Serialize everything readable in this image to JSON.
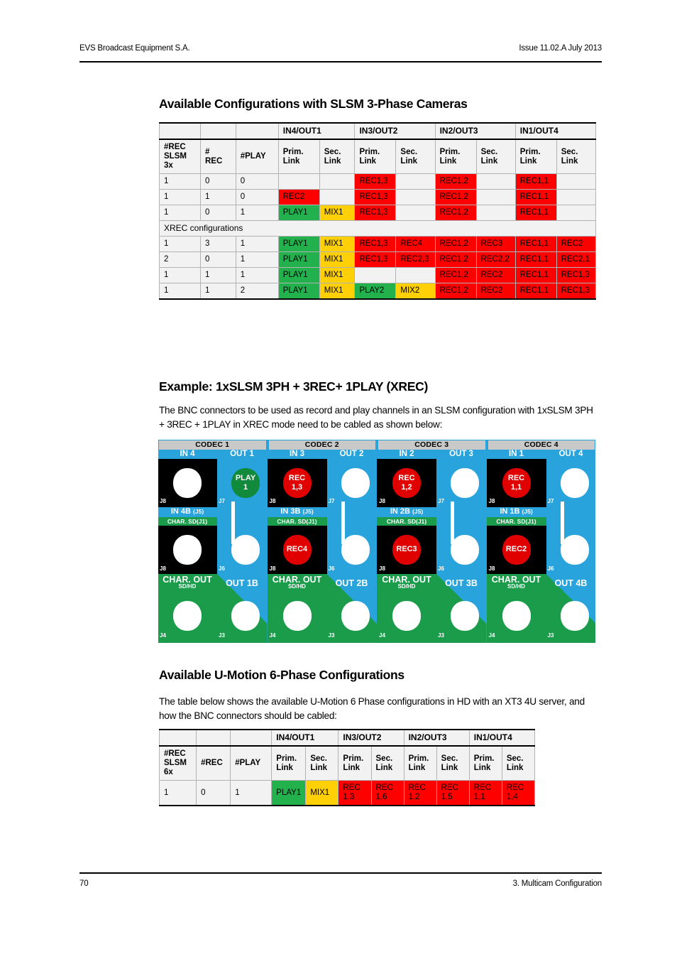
{
  "header": {
    "company": "EVS Broadcast Equipment S.A.",
    "issue": "Issue 11.02.A  July 2013"
  },
  "footer": {
    "page_number": "70",
    "chapter": "3. Multicam Configuration"
  },
  "sections": {
    "title_1": "Available Configurations with SLSM 3-Phase Cameras",
    "title_2": "Example: 1xSLSM 3PH + 3REC+ 1PLAY (XREC)",
    "title_3": "Available U-Motion 6-Phase Configurations",
    "para_1": "The BNC connectors to be used as record and play channels in an SLSM configuration with 1xSLSM 3PH + 3REC + 1PLAY in XREC mode need to be cabled as shown below:",
    "para_2": "The table below shows the available U-Motion 6 Phase configurations in HD with an XT3 4U server, and how the BNC connectors should be cabled:"
  },
  "colors": {
    "rec": "#fe0000",
    "play": "#22b14c",
    "mix": "#ffd005",
    "panel_blue": "#29a3dc",
    "panel_green": "#1a9c4b",
    "codec_bar": "#c9c9c9"
  },
  "table_1": {
    "group_headers": [
      "",
      "",
      "",
      "IN4/OUT1",
      "IN3/OUT2",
      "IN2/OUT3",
      "IN1/OUT4"
    ],
    "sub_headers": [
      "#REC SLSM 3x",
      "# REC",
      "#PLAY",
      "Prim. Link",
      "Sec. Link",
      "Prim. Link",
      "Sec. Link",
      "Prim. Link",
      "Sec. Link",
      "Prim. Link",
      "Sec. Link"
    ],
    "sub_headers_split": [
      {
        "l1": "#REC",
        "l2": "SLSM",
        "l3": "3x"
      },
      {
        "l1": "#",
        "l2": "REC"
      },
      {
        "l1": "#PLAY"
      },
      {
        "l1": "Prim.",
        "l2": "Link"
      },
      {
        "l1": "Sec.",
        "l2": "Link"
      },
      {
        "l1": "Prim.",
        "l2": "Link"
      },
      {
        "l1": "Sec.",
        "l2": "Link"
      },
      {
        "l1": "Prim.",
        "l2": "Link"
      },
      {
        "l1": "Sec.",
        "l2": "Link"
      },
      {
        "l1": "Prim.",
        "l2": "Link"
      },
      {
        "l1": "Sec.",
        "l2": "Link"
      }
    ],
    "section_label": "XREC configurations",
    "rows": [
      {
        "cells": [
          {
            "t": "1",
            "k": "plain"
          },
          {
            "t": "0",
            "k": "plain"
          },
          {
            "t": "0",
            "k": "plain"
          },
          {
            "t": "",
            "k": "empty"
          },
          {
            "t": "",
            "k": "empty"
          },
          {
            "t": "REC1,3",
            "k": "rec"
          },
          {
            "t": "",
            "k": "empty"
          },
          {
            "t": "REC1,2",
            "k": "rec"
          },
          {
            "t": "",
            "k": "empty"
          },
          {
            "t": "REC1,1",
            "k": "rec"
          },
          {
            "t": "",
            "k": "empty"
          }
        ]
      },
      {
        "cells": [
          {
            "t": "1",
            "k": "plain"
          },
          {
            "t": "1",
            "k": "plain"
          },
          {
            "t": "0",
            "k": "plain"
          },
          {
            "t": "REC2",
            "k": "rec"
          },
          {
            "t": "",
            "k": "empty"
          },
          {
            "t": "REC1,3",
            "k": "rec"
          },
          {
            "t": "",
            "k": "empty"
          },
          {
            "t": "REC1,2",
            "k": "rec"
          },
          {
            "t": "",
            "k": "empty"
          },
          {
            "t": "REC1,1",
            "k": "rec"
          },
          {
            "t": "",
            "k": "empty"
          }
        ]
      },
      {
        "cells": [
          {
            "t": "1",
            "k": "plain"
          },
          {
            "t": "0",
            "k": "plain"
          },
          {
            "t": "1",
            "k": "plain"
          },
          {
            "t": "PLAY1",
            "k": "play"
          },
          {
            "t": "MIX1",
            "k": "mix"
          },
          {
            "t": "REC1,3",
            "k": "rec"
          },
          {
            "t": "",
            "k": "empty"
          },
          {
            "t": "REC1,2",
            "k": "rec"
          },
          {
            "t": "",
            "k": "empty"
          },
          {
            "t": "REC1,1",
            "k": "rec"
          },
          {
            "t": "",
            "k": "empty"
          }
        ]
      }
    ],
    "xrec_rows": [
      {
        "cells": [
          {
            "t": "1",
            "k": "plain"
          },
          {
            "t": "3",
            "k": "plain"
          },
          {
            "t": "1",
            "k": "plain"
          },
          {
            "t": "PLAY1",
            "k": "play"
          },
          {
            "t": "MIX1",
            "k": "mix"
          },
          {
            "t": "REC1,3",
            "k": "rec"
          },
          {
            "t": "REC4",
            "k": "rec"
          },
          {
            "t": "REC1,2",
            "k": "rec"
          },
          {
            "t": "REC3",
            "k": "rec"
          },
          {
            "t": "REC1,1",
            "k": "rec"
          },
          {
            "t": "REC2",
            "k": "rec"
          }
        ]
      },
      {
        "cells": [
          {
            "t": "2",
            "k": "plain"
          },
          {
            "t": "0",
            "k": "plain"
          },
          {
            "t": "1",
            "k": "plain"
          },
          {
            "t": "PLAY1",
            "k": "play"
          },
          {
            "t": "MIX1",
            "k": "mix"
          },
          {
            "t": "REC1,3",
            "k": "rec"
          },
          {
            "t": "REC2,3",
            "k": "rec"
          },
          {
            "t": "REC1,2",
            "k": "rec"
          },
          {
            "t": "REC2,2",
            "k": "rec"
          },
          {
            "t": "REC1,1",
            "k": "rec"
          },
          {
            "t": "REC2,1",
            "k": "rec"
          }
        ]
      },
      {
        "cells": [
          {
            "t": "1",
            "k": "plain"
          },
          {
            "t": "1",
            "k": "plain"
          },
          {
            "t": "1",
            "k": "plain"
          },
          {
            "t": "PLAY1",
            "k": "play"
          },
          {
            "t": "MIX1",
            "k": "mix"
          },
          {
            "t": "",
            "k": "empty"
          },
          {
            "t": "",
            "k": "empty"
          },
          {
            "t": "REC1,2",
            "k": "rec"
          },
          {
            "t": "REC2",
            "k": "rec"
          },
          {
            "t": "REC1,1",
            "k": "rec"
          },
          {
            "t": "REC1,3",
            "k": "rec"
          }
        ]
      },
      {
        "cells": [
          {
            "t": "1",
            "k": "plain"
          },
          {
            "t": "1",
            "k": "plain"
          },
          {
            "t": "2",
            "k": "plain"
          },
          {
            "t": "PLAY1",
            "k": "play"
          },
          {
            "t": "MIX1",
            "k": "mix"
          },
          {
            "t": "PLAY2",
            "k": "play"
          },
          {
            "t": "MIX2",
            "k": "mix"
          },
          {
            "t": "REC1,2",
            "k": "rec"
          },
          {
            "t": "REC2",
            "k": "rec"
          },
          {
            "t": "REC1,1",
            "k": "rec"
          },
          {
            "t": "REC1,3",
            "k": "rec"
          }
        ]
      }
    ]
  },
  "table_2": {
    "group_headers": [
      "",
      "",
      "",
      "IN4/OUT1",
      "IN3/OUT2",
      "IN2/OUT3",
      "IN1/OUT4"
    ],
    "sub_headers_split": [
      {
        "l1": "#REC",
        "l2": "SLSM",
        "l3": "6x"
      },
      {
        "l1": "#REC"
      },
      {
        "l1": "#PLAY"
      },
      {
        "l1": "Prim.",
        "l2": "Link"
      },
      {
        "l1": "Sec.",
        "l2": "Link"
      },
      {
        "l1": "Prim.",
        "l2": "Link"
      },
      {
        "l1": "Sec.",
        "l2": "Link"
      },
      {
        "l1": "Prim.",
        "l2": "Link"
      },
      {
        "l1": "Sec.",
        "l2": "Link"
      },
      {
        "l1": "Prim.",
        "l2": "Link"
      },
      {
        "l1": "Sec.",
        "l2": "Link"
      }
    ],
    "rows": [
      {
        "cells": [
          {
            "t": "1",
            "k": "plain"
          },
          {
            "t": "0",
            "k": "plain"
          },
          {
            "t": "1",
            "k": "plain"
          },
          {
            "t": "PLAY1",
            "k": "play"
          },
          {
            "t": "MIX1",
            "k": "mix"
          },
          {
            "t": "REC 1,3",
            "k": "rec"
          },
          {
            "t": "REC 1,6",
            "k": "rec"
          },
          {
            "t": "REC 1,2",
            "k": "rec"
          },
          {
            "t": "REC 1,5",
            "k": "rec"
          },
          {
            "t": "REC 1,1",
            "k": "rec"
          },
          {
            "t": "REC 1,4",
            "k": "rec"
          }
        ]
      }
    ]
  },
  "diagram": {
    "codecs": [
      {
        "title": "CODEC 1",
        "in_label": "IN 4",
        "out_label": "OUT 1",
        "inb_label": "IN 4B",
        "inb_pin": "(J5)",
        "charsd_label": "CHAR. SD",
        "charsd_pin": "(J1)",
        "charout_label": "CHAR. OUT",
        "charout_sub": "SD/HD",
        "outb_label": "OUT 1B",
        "pins": {
          "top_left": "J8",
          "top_right": "J7",
          "mid_left": "J8b",
          "mid_right": "J6",
          "bot_left": "J4",
          "bot_right": "J3"
        },
        "in_bnc": {
          "state": "idle",
          "label": ""
        },
        "out_bnc": {
          "state": "play",
          "l1": "PLAY",
          "l2": "1"
        },
        "inb_bnc": {
          "state": "idle",
          "label": ""
        },
        "outb_bnc": {
          "state": "idle",
          "label": ""
        },
        "cable": true
      },
      {
        "title": "CODEC 2",
        "in_label": "IN 3",
        "out_label": "OUT 2",
        "inb_label": "IN 3B",
        "inb_pin": "(J5)",
        "charsd_label": "CHAR. SD",
        "charsd_pin": "(J1)",
        "charout_label": "CHAR. OUT",
        "charout_sub": "SD/HD",
        "outb_label": "OUT 2B",
        "pins": {
          "top_left": "J8",
          "top_right": "J7",
          "mid_left": "J8b",
          "mid_right": "J6",
          "bot_left": "J4",
          "bot_right": "J3"
        },
        "in_bnc": {
          "state": "rec",
          "l1": "REC",
          "l2": "1,3"
        },
        "out_bnc": {
          "state": "idle",
          "label": ""
        },
        "inb_bnc": {
          "state": "rec",
          "l1": "REC4",
          "l2": ""
        },
        "outb_bnc": {
          "state": "idle",
          "label": ""
        },
        "cable": true
      },
      {
        "title": "CODEC 3",
        "in_label": "IN 2",
        "out_label": "OUT 3",
        "inb_label": "IN 2B",
        "inb_pin": "(J5)",
        "charsd_label": "CHAR. SD",
        "charsd_pin": "(J1)",
        "charout_label": "CHAR. OUT",
        "charout_sub": "SD/HD",
        "outb_label": "OUT 3B",
        "pins": {
          "top_left": "J8",
          "top_right": "J7",
          "mid_left": "J8b",
          "mid_right": "J6",
          "bot_left": "J4",
          "bot_right": "J3"
        },
        "in_bnc": {
          "state": "rec",
          "l1": "REC",
          "l2": "1,2"
        },
        "out_bnc": {
          "state": "idle",
          "label": ""
        },
        "inb_bnc": {
          "state": "rec",
          "l1": "REC3",
          "l2": ""
        },
        "outb_bnc": {
          "state": "idle",
          "label": ""
        },
        "cable": true
      },
      {
        "title": "CODEC 4",
        "in_label": "IN 1",
        "out_label": "OUT 4",
        "inb_label": "IN 1B",
        "inb_pin": "(J5)",
        "charsd_label": "CHAR. SD",
        "charsd_pin": "(J1)",
        "charout_label": "CHAR. OUT",
        "charout_sub": "SD/HD",
        "outb_label": "OUT 4B",
        "pins": {
          "top_left": "J8",
          "top_right": "J7",
          "mid_left": "J8b",
          "mid_right": "J6",
          "bot_left": "J4",
          "bot_right": "J3"
        },
        "in_bnc": {
          "state": "rec",
          "l1": "REC",
          "l2": "1,1"
        },
        "out_bnc": {
          "state": "idle",
          "label": ""
        },
        "inb_bnc": {
          "state": "rec",
          "l1": "REC2",
          "l2": ""
        },
        "outb_bnc": {
          "state": "idle",
          "label": ""
        },
        "cable": true
      }
    ]
  }
}
